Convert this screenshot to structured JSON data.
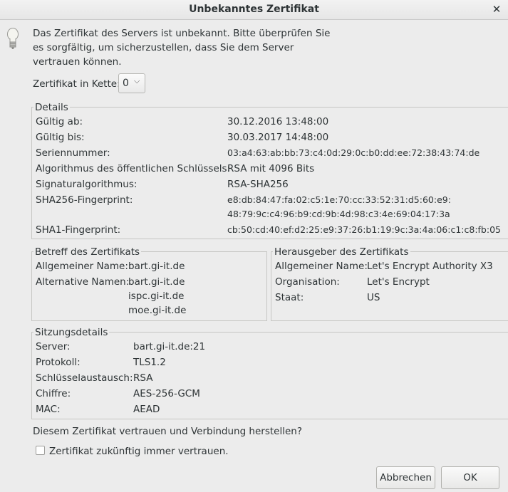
{
  "window": {
    "title": "Unbekanntes Zertifikat"
  },
  "message": "Das Zertifikat des Servers ist unbekannt. Bitte überprüfen Sie es sorgfältig, um sicherzustellen, dass Sie dem Server vertrauen können.",
  "chain": {
    "label": "Zertifikat in Kette:",
    "value": "0"
  },
  "details": {
    "legend": "Details",
    "rows": [
      {
        "label": "Gültig ab:",
        "value": "30.12.2016 13:48:00"
      },
      {
        "label": "Gültig bis:",
        "value": "30.03.2017 14:48:00"
      },
      {
        "label": "Seriennummer:",
        "value": "03:a4:63:ab:bb:73:c4:0d:29:0c:b0:dd:ee:72:38:43:74:de"
      },
      {
        "label": "Algorithmus des öffentlichen Schlüssels:",
        "value": "RSA mit 4096 Bits"
      },
      {
        "label": "Signaturalgorithmus:",
        "value": "RSA-SHA256"
      },
      {
        "label": "SHA256-Fingerprint:",
        "value": "e8:db:84:47:fa:02:c5:1e:70:cc:33:52:31:d5:60:e9:",
        "value2": "48:79:9c:c4:96:b9:cd:9b:4d:98:c3:4e:69:04:17:3a"
      },
      {
        "label": "SHA1-Fingerprint:",
        "value": "cb:50:cd:40:ef:d2:25:e9:37:26:b1:19:9c:3a:4a:06:c1:c8:fb:05"
      }
    ]
  },
  "subject": {
    "legend": "Betreff des Zertifikats",
    "common_name_label": "Allgemeiner Name:",
    "common_name": "bart.gi-it.de",
    "alt_names_label": "Alternative Namen:",
    "alt_names": [
      "bart.gi-it.de",
      "ispc.gi-it.de",
      "moe.gi-it.de"
    ]
  },
  "issuer": {
    "legend": "Herausgeber des Zertifikats",
    "rows": [
      {
        "label": "Allgemeiner Name:",
        "value": "Let's Encrypt Authority X3"
      },
      {
        "label": "Organisation:",
        "value": "Let's Encrypt"
      },
      {
        "label": "Staat:",
        "value": "US"
      }
    ]
  },
  "session": {
    "legend": "Sitzungsdetails",
    "rows": [
      {
        "label": "Server:",
        "value": "bart.gi-it.de:21"
      },
      {
        "label": "Protokoll:",
        "value": "TLS1.2"
      },
      {
        "label": "Schlüsselaustausch:",
        "value": "RSA"
      },
      {
        "label": "Chiffre:",
        "value": "AES-256-GCM"
      },
      {
        "label": "MAC:",
        "value": "AEAD"
      }
    ]
  },
  "question": "Diesem Zertifikat vertrauen und Verbindung herstellen?",
  "checkbox": {
    "label": "Zertifikat zukünftig immer vertrauen.",
    "checked": false
  },
  "buttons": {
    "cancel": "Abbrechen",
    "ok": "OK"
  },
  "icons": {
    "hint": "lightbulb-icon",
    "close": "close-icon",
    "dropdown": "chevron-down-icon"
  }
}
